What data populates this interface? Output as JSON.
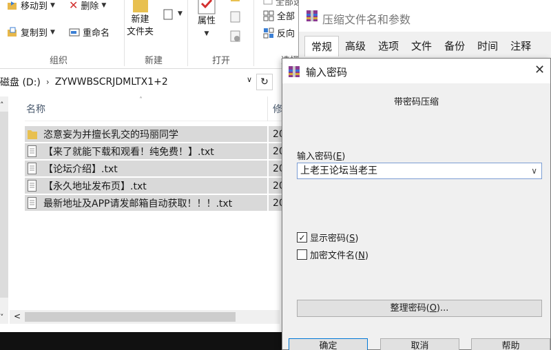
{
  "explorer": {
    "ribbon": {
      "move_to": "移动到",
      "delete": "删除",
      "copy_to": "复制到",
      "rename": "重命名",
      "new_folder_line1": "新建",
      "new_folder_line2": "文件夹",
      "properties": "属性",
      "select_all": "全部",
      "invert": "反向",
      "top_partial": "全部选择",
      "groups": [
        "组织",
        "新建",
        "打开",
        "选择"
      ]
    },
    "address": {
      "drive": "磁盘 (D:)",
      "folder": "ZYWWBSCRJDMLTX1+2",
      "refresh_icon": "refresh-icon"
    },
    "columns": {
      "name": "名称",
      "modified": "修"
    },
    "files": [
      {
        "name": "恣意妄为并擅长乳交的玛丽同学",
        "type": "folder",
        "modified": "20"
      },
      {
        "name": "【来了就能下载和观看！纯免费！】.txt",
        "type": "txt",
        "modified": "20"
      },
      {
        "name": "【论坛介绍】.txt",
        "type": "txt",
        "modified": "20"
      },
      {
        "name": "【永久地址发布页】.txt",
        "type": "txt",
        "modified": "20"
      },
      {
        "name": "最新地址及APP请发邮箱自动获取！！！.txt",
        "type": "txt",
        "modified": "20"
      }
    ]
  },
  "rar_dialog": {
    "title": "压缩文件名和参数",
    "tabs": [
      "常规",
      "高级",
      "选项",
      "文件",
      "备份",
      "时间",
      "注释"
    ]
  },
  "password_dialog": {
    "title": "输入密码",
    "heading": "带密码压缩",
    "label": "输入密码(",
    "label_key": "E",
    "label_end": ")",
    "password_value": "上老王论坛当老王",
    "show_password": {
      "label": "显示密码(",
      "key": "S",
      "end": ")",
      "checked": true
    },
    "encrypt_filenames": {
      "label": "加密文件名(",
      "key": "N",
      "end": ")",
      "checked": false
    },
    "organize_button": {
      "label": "整理密码(",
      "key": "O",
      "end": ")..."
    },
    "ok_button": "确定",
    "cancel_button": "取消",
    "help_button": "帮助"
  }
}
